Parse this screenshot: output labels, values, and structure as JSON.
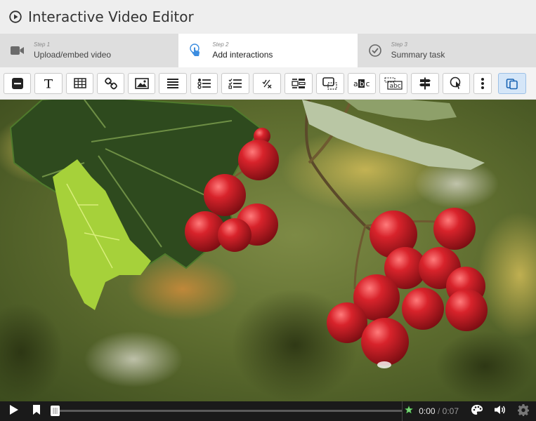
{
  "app": {
    "title": "Interactive Video Editor",
    "icons": {
      "logo": "play-circle-icon"
    }
  },
  "steps": [
    {
      "number": "Step 1",
      "label": "Upload/embed video",
      "icon": "video-camera-icon",
      "active": false
    },
    {
      "number": "Step 2",
      "label": "Add interactions",
      "icon": "tap-hand-icon",
      "active": true
    },
    {
      "number": "Step 3",
      "label": "Summary task",
      "icon": "check-circle-icon",
      "active": false
    }
  ],
  "toolbar": {
    "tools": [
      "label-icon",
      "text-icon",
      "table-icon",
      "link-icon",
      "image-icon",
      "statements-icon",
      "single-choice-icon",
      "multiple-choice-icon",
      "true-false-icon",
      "drag-text-icon",
      "drag-drop-icon",
      "fill-blanks-icon",
      "mark-words-icon",
      "crossroads-icon",
      "navigation-hotspot-icon",
      "more-icon"
    ],
    "paste_icon": "paste-icon"
  },
  "player": {
    "current_time": "0:00",
    "separator": "/",
    "total_time": "0:07",
    "icons": [
      "play-icon",
      "bookmark-icon",
      "chapter-marker-icon",
      "star-icon",
      "palette-icon",
      "volume-icon",
      "settings-icon"
    ],
    "progress": 0
  }
}
